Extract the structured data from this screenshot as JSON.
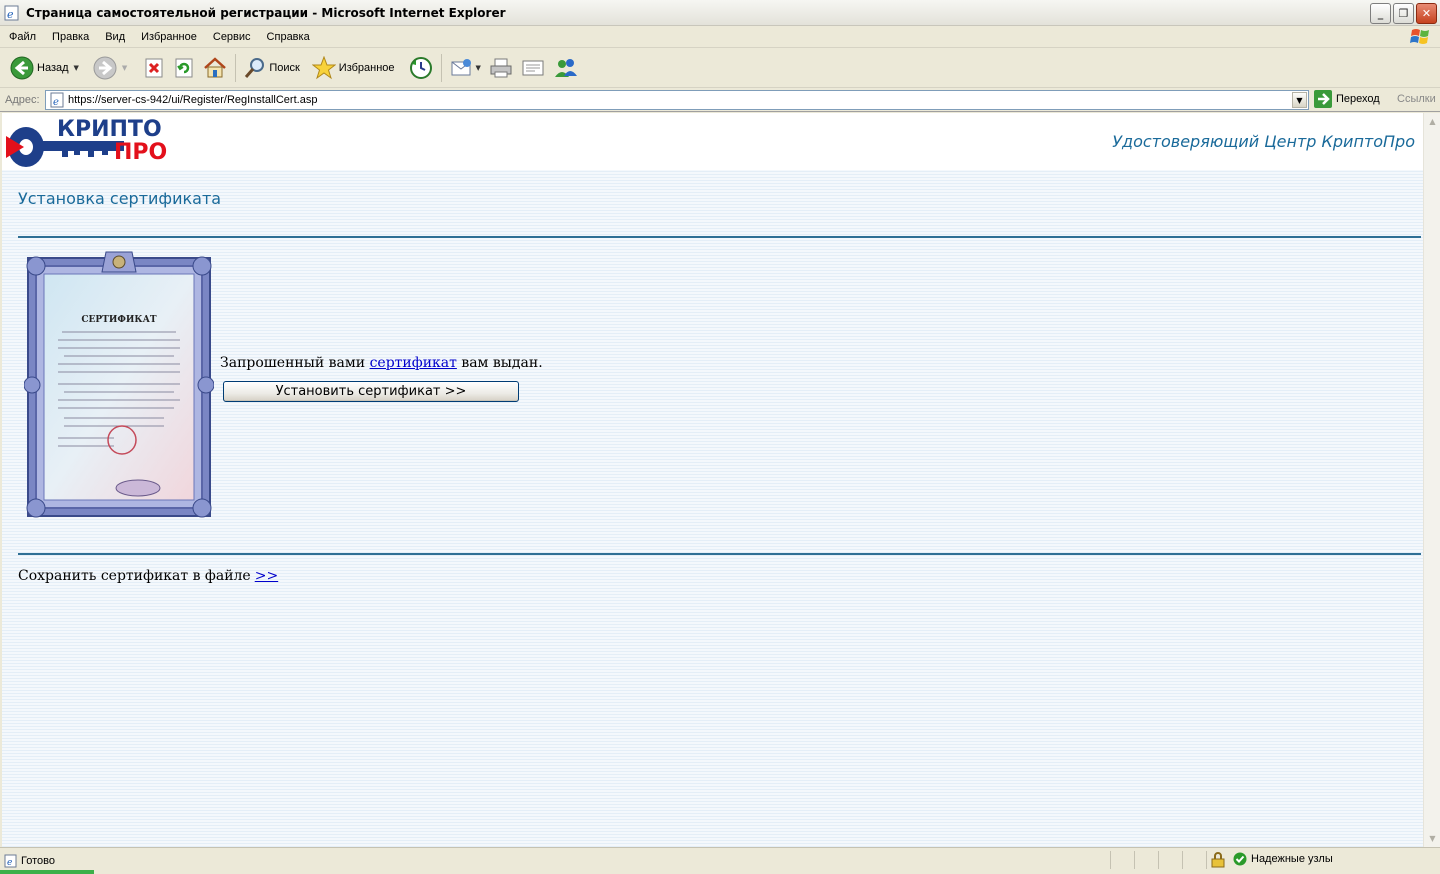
{
  "window": {
    "title": "Страница самостоятельной регистрации - Microsoft Internet Explorer",
    "minimize": "_",
    "maximize": "❐",
    "close": "✕"
  },
  "menu": [
    "Файл",
    "Правка",
    "Вид",
    "Избранное",
    "Сервис",
    "Справка"
  ],
  "toolbar": {
    "back_label": "Назад",
    "search_label": "Поиск",
    "favorites_label": "Избранное"
  },
  "address": {
    "label": "Адрес:",
    "url": "https://server-cs-942/ui/Register/RegInstallCert.asp",
    "go_label": "Переход",
    "links_label": "Ссылки"
  },
  "header": {
    "logo_text_line1": "КРИПТО",
    "logo_text_line2": "ПРО",
    "ca_title": "Удостоверяющий Центр КриптоПро"
  },
  "content": {
    "page_title": "Установка сертификата",
    "issued_prefix": "Запрошенный вами ",
    "issued_link": "сертификат",
    "issued_suffix": " вам выдан.",
    "install_button": "Установить сертификат >>",
    "save_text": "Сохранить сертификат в файле",
    "save_link": ">>",
    "cert_heading": "СЕРТИФИКАТ"
  },
  "status": {
    "text": "Готово",
    "zone": "Надежные узлы"
  },
  "colors": {
    "accent": "#1a6a9a",
    "rule": "#2f6f94",
    "logo_blue": "#1e3f8a",
    "logo_red": "#e3101b"
  }
}
